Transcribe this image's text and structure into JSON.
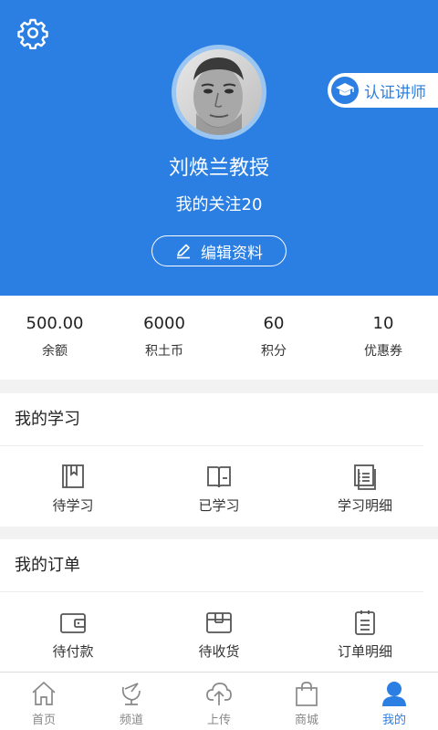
{
  "profile": {
    "name": "刘焕兰教授",
    "follow_text": "我的关注20",
    "edit_label": "编辑资料",
    "cert_label": "认证讲师"
  },
  "stats": [
    {
      "value": "500.00",
      "label": "余额"
    },
    {
      "value": "6000",
      "label": "积土币"
    },
    {
      "value": "60",
      "label": "积分"
    },
    {
      "value": "10",
      "label": "优惠券"
    }
  ],
  "study": {
    "title": "我的学习",
    "items": [
      {
        "label": "待学习",
        "icon": "bookmark-book-icon"
      },
      {
        "label": "已学习",
        "icon": "open-book-icon"
      },
      {
        "label": "学习明细",
        "icon": "list-detail-icon"
      }
    ]
  },
  "orders": {
    "title": "我的订单",
    "items": [
      {
        "label": "待付款",
        "icon": "wallet-icon"
      },
      {
        "label": "待收货",
        "icon": "package-icon"
      },
      {
        "label": "订单明细",
        "icon": "clipboard-list-icon"
      }
    ]
  },
  "tabs": [
    {
      "label": "首页",
      "icon": "home-icon"
    },
    {
      "label": "频道",
      "icon": "satellite-dish-icon"
    },
    {
      "label": "上传",
      "icon": "cloud-upload-icon"
    },
    {
      "label": "商城",
      "icon": "shopping-bag-icon"
    },
    {
      "label": "我的",
      "icon": "user-icon",
      "active": true
    }
  ],
  "colors": {
    "primary": "#2b7fe3",
    "inactive_tab": "#888888"
  }
}
